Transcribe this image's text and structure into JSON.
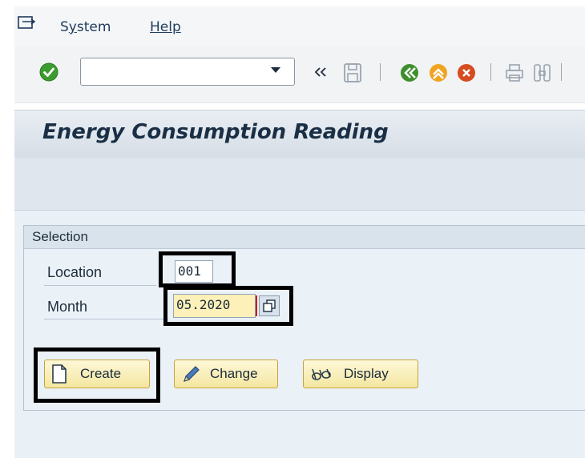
{
  "menu": {
    "system_label": "System",
    "help_label": "Help"
  },
  "toolbar": {
    "command_field_value": "",
    "icons": [
      "enter-icon",
      "dropdown-icon",
      "double-chevron-icon",
      "save-icon",
      "back-icon",
      "exit-icon",
      "cancel-icon",
      "print-icon",
      "find-icon"
    ]
  },
  "title": "Energy Consumption Reading",
  "selection": {
    "group_title": "Selection",
    "location_label": "Location",
    "location_value": "001",
    "month_label": "Month",
    "month_value": "05.2020"
  },
  "buttons": {
    "create": "Create",
    "change": "Change",
    "display": "Display"
  },
  "colors": {
    "accent_highlight": "#000000",
    "required_field": "#fdf0b8",
    "button_bg": "#f7edb7"
  }
}
